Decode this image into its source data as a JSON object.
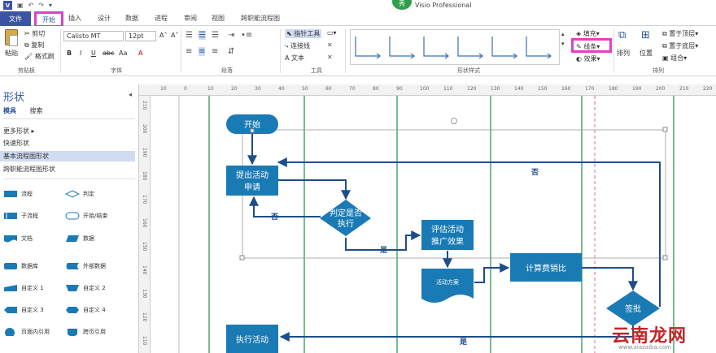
{
  "titlebar": {
    "app_title": "Visio Professional",
    "badge": "秀",
    "logo": "V"
  },
  "tabs": {
    "file": "文件",
    "home": "开始",
    "insert": "插入",
    "design": "设计",
    "data": "数据",
    "process": "进程",
    "review": "审阅",
    "view": "视图",
    "cross": "跨职能流程图"
  },
  "ribbon": {
    "clipboard": {
      "paste": "粘贴",
      "cut": "剪切",
      "copy": "复制",
      "format_painter": "格式刷",
      "label": "剪贴板"
    },
    "font": {
      "name": "Calisto MT",
      "size": "12pt",
      "label": "字体",
      "bold": "B",
      "italic": "I",
      "underline": "U",
      "strike": "abc",
      "case": "Aa",
      "grow": "A˄",
      "shrink": "A˅",
      "color": "A"
    },
    "paragraph": {
      "label": "段落"
    },
    "tools": {
      "pointer": "指针工具",
      "connector": "连接线",
      "text": "文本",
      "label": "工具"
    },
    "shape_styles": {
      "label": "形状样式",
      "fill": "填充",
      "line": "线条",
      "effect": "效果"
    },
    "arrange": {
      "label": "排列",
      "arrange": "排列",
      "position": "位置",
      "bring_front": "置于顶层",
      "send_back": "置于底层",
      "group": "组合"
    }
  },
  "panel": {
    "title": "形状",
    "tab_stencils": "模具",
    "tab_search": "搜索",
    "more_shapes": "更多形状",
    "quick_shapes": "快速形状",
    "basic_flowchart": "基本流程图形状",
    "cross_functional": "跨职能流程图形状",
    "shapes": [
      {
        "label": "流程"
      },
      {
        "label": "判定"
      },
      {
        "label": "子流程"
      },
      {
        "label": "开始/结束"
      },
      {
        "label": "文档"
      },
      {
        "label": "数据"
      },
      {
        "label": "数据库"
      },
      {
        "label": "外部数据"
      },
      {
        "label": "自定义 1"
      },
      {
        "label": "自定义 2"
      },
      {
        "label": "自定义 3"
      },
      {
        "label": "自定义 4"
      },
      {
        "label": "页面内引用"
      },
      {
        "label": "跨页引用"
      }
    ]
  },
  "ruler": {
    "top": [
      "10",
      "0",
      "10",
      "20",
      "30",
      "40",
      "50",
      "60",
      "70",
      "80",
      "90",
      "100",
      "110",
      "120",
      "130",
      "140",
      "150",
      "160",
      "170",
      "180",
      "190",
      "200",
      "210",
      "220"
    ],
    "left": [
      "210",
      "200",
      "190",
      "180",
      "170",
      "160",
      "150",
      "140",
      "130",
      "120",
      "110"
    ]
  },
  "flowchart": {
    "start": "开始",
    "submit_1": "提出活动",
    "submit_2": "申请",
    "judge_1": "判定是否",
    "judge_2": "执行",
    "eval_1": "评估活动",
    "eval_2": "推广效果",
    "plan": "活动方案",
    "calc": "计算费销比",
    "sign": "签批",
    "execute": "执行活动",
    "no_1": "否",
    "no_2": "否",
    "yes_1": "是",
    "yes_2": "是"
  },
  "colors": {
    "shape": "#1a7ab4",
    "connector": "#1d4e89",
    "lane": "#3aa35a",
    "accent": "#2b579a",
    "highlight": "#e040c8"
  },
  "watermark": {
    "brand": "云南龙网",
    "sub": "www.xiazaiba.com"
  }
}
